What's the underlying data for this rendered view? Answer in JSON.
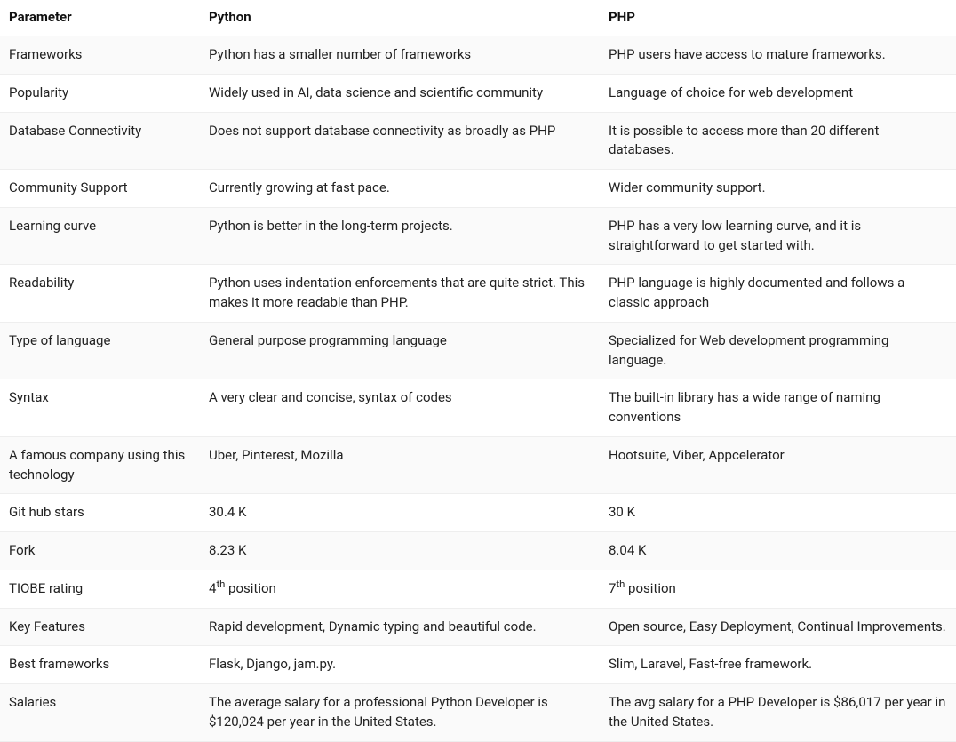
{
  "table": {
    "headers": [
      "Parameter",
      "Python",
      "PHP"
    ],
    "rows": [
      {
        "parameter": "Frameworks",
        "python": "Python has a smaller number of frameworks",
        "php": "PHP users have access to mature frameworks."
      },
      {
        "parameter": "Popularity",
        "python": "Widely used in AI, data science and scientific community",
        "php": "Language of choice for web development"
      },
      {
        "parameter": "Database Connectivity",
        "python": "Does not support database connectivity as broadly as PHP",
        "php": "It is possible to access more than 20 different databases."
      },
      {
        "parameter": "Community Support",
        "python": "Currently growing at fast pace.",
        "php": "Wider community support."
      },
      {
        "parameter": "Learning curve",
        "python": "Python is better in the long-term projects.",
        "php": "PHP has a very low learning curve, and it is straightforward to get started with."
      },
      {
        "parameter": "Readability",
        "python": "Python uses indentation enforcements that are quite strict. This makes it more readable than PHP.",
        "php": "PHP language is highly documented and follows a classic approach"
      },
      {
        "parameter": "Type of language",
        "python": "General purpose programming language",
        "php": "Specialized for Web development programming language."
      },
      {
        "parameter": "Syntax",
        "python": "A very clear and concise, syntax of codes",
        "php": "The built-in library has a wide range of naming conventions"
      },
      {
        "parameter": "A famous company using this technology",
        "python": "Uber, Pinterest, Mozilla",
        "php": "Hootsuite, Viber, Appcelerator"
      },
      {
        "parameter": "Git hub stars",
        "python": "30.4 K",
        "php": "30 K"
      },
      {
        "parameter": "Fork",
        "python": "8.23 K",
        "php": "8.04 K"
      },
      {
        "parameter": "TIOBE rating",
        "python_html": "4<sup>th</sup> position",
        "php_html": "7<sup>th</sup> position"
      },
      {
        "parameter": "Key Features",
        "python": "Rapid development, Dynamic typing and beautiful code.",
        "php": "Open source, Easy Deployment, Continual Improvements."
      },
      {
        "parameter": "Best frameworks",
        "python": "Flask, Django, jam.py.",
        "php": "Slim, Laravel, Fast-free framework."
      },
      {
        "parameter": "Salaries",
        "python": "The average salary for a professional Python Developer is $120,024 per year in the United States.",
        "php": "The avg salary for a PHP Developer is $86,017 per year in the United States."
      }
    ]
  }
}
